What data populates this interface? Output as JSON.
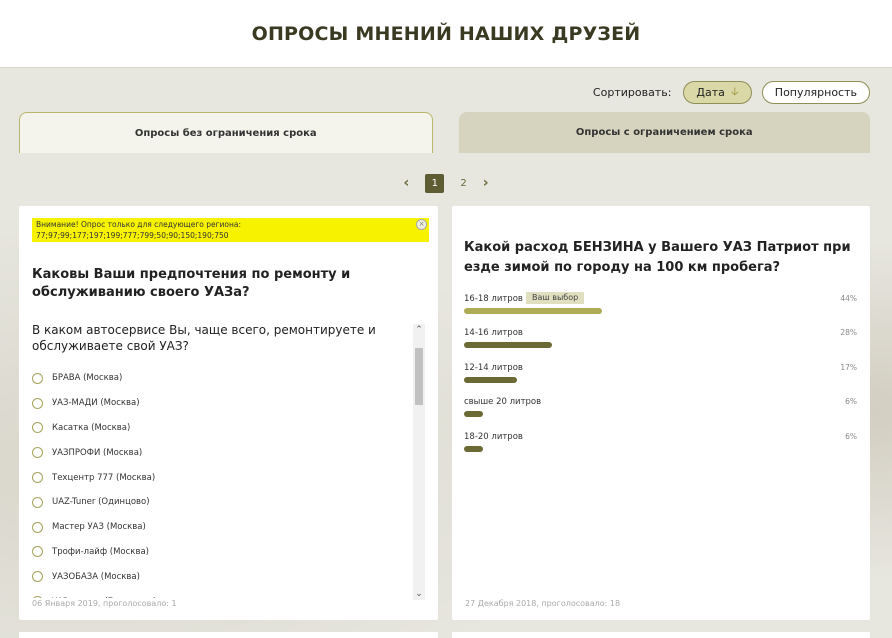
{
  "header": {
    "title": "ОПРОСЫ МНЕНИЙ НАШИХ ДРУЗЕЙ"
  },
  "sort": {
    "label": "Сортировать:",
    "date_label": "Дата",
    "popularity_label": "Популярность"
  },
  "tabs": [
    {
      "label": "Опросы без ограничения срока"
    },
    {
      "label": "Опросы с ограничением срока"
    }
  ],
  "pager": {
    "current": "1",
    "next_page": "2"
  },
  "left_poll": {
    "warning": "Внимание! Опрос только для следующего региона: 77;97;99;177;197;199;777;799;50;90;150;190;750",
    "title": "Каковы Ваши предпочтения по ремонту и обслуживанию своего УАЗа?",
    "question": "В каком автосервисе Вы, чаще всего, ремонтируете и обслуживаете свой УАЗ?",
    "options": [
      "БРАВА (Москва)",
      "УАЗ-МАДИ (Москва)",
      "Касатка (Москва)",
      "УАЗПРОФИ (Москва)",
      "Техцентр 777 (Москва)",
      "UAZ-Tuner (Одинцово)",
      "Мастер УАЗ (Москва)",
      "Трофи-лайф (Москва)",
      "УАЗОБАЗА (Москва)",
      "УАЗ сервис (Балашиха)"
    ],
    "footer": "06 Января 2019, проголосовало: 1"
  },
  "right_poll": {
    "title": "Какой расход БЕНЗИНА у Вашего УАЗ Патриот при езде зимой по городу на 100 км пробега?",
    "your_choice_label": "Ваш выбор",
    "results": [
      {
        "label": "16-18 литров",
        "pct": "44%",
        "value": 44,
        "chosen": true
      },
      {
        "label": "14-16 литров",
        "pct": "28%",
        "value": 28,
        "chosen": false
      },
      {
        "label": "12-14 литров",
        "pct": "17%",
        "value": 17,
        "chosen": false
      },
      {
        "label": "свыше 20 литров",
        "pct": "6%",
        "value": 6,
        "chosen": false
      },
      {
        "label": "18-20 литров",
        "pct": "6%",
        "value": 6,
        "chosen": false
      }
    ],
    "footer": "27 Декабря 2018, проголосовало: 18"
  }
}
